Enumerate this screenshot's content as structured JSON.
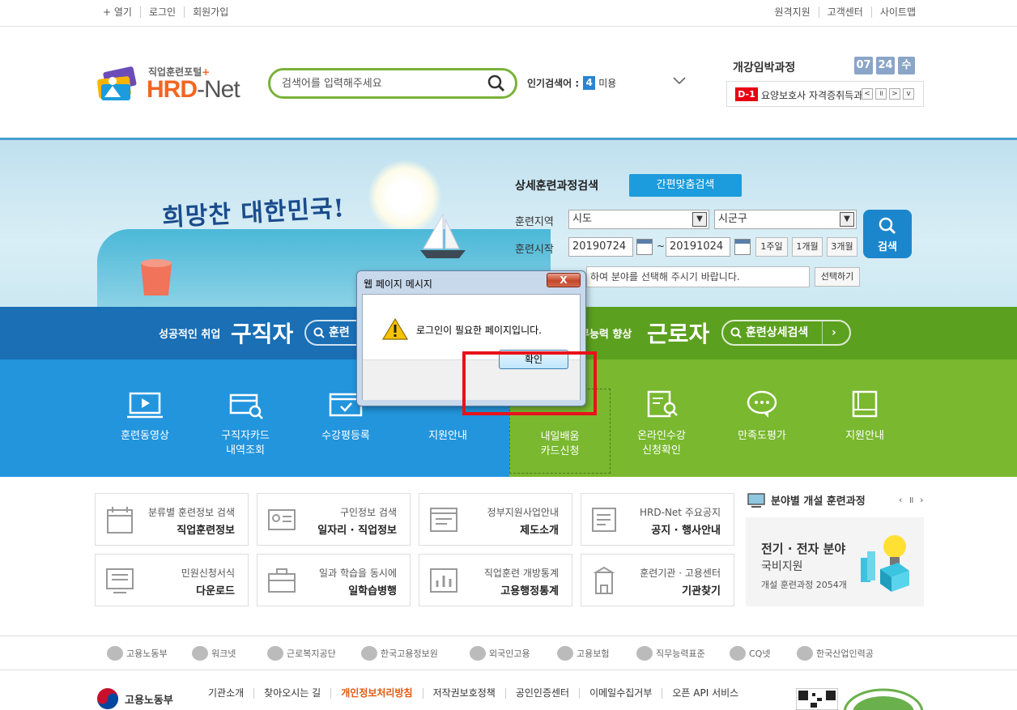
{
  "util": {
    "left": [
      "+ 열기",
      "로그인",
      "회원가입"
    ],
    "right": [
      "원격지원",
      "고객센터",
      "사이트맵"
    ]
  },
  "logo": {
    "pre": "직업훈련포털",
    "plus": "+",
    "hrd": "HRD",
    "net": "-Net"
  },
  "search": {
    "placeholder": "검색어를 입력해주세요"
  },
  "popular": {
    "label": "인기검색어 :",
    "rank": "4",
    "word": "미용"
  },
  "course": {
    "title": "개강임박과정",
    "month": "07",
    "day": "24",
    "weekday": "수",
    "dday": "D-1",
    "name": "요양보호사 자격증취득과정"
  },
  "hero": {
    "slogan": "희망찬 대한민국!",
    "form_title": "상세훈련과정검색",
    "quick_btn": "간편맞춤검색",
    "region_label": "훈련지역",
    "region_sido": "시도",
    "region_gugun": "시군구",
    "start_label": "훈련시작",
    "date_from": "20190724",
    "tilde": "~",
    "date_to": "20191024",
    "p1": "1주일",
    "p2": "1개월",
    "p3": "3개월",
    "field_text": "하여 분야를 선택해 주시기 바랍니다.",
    "select_btn": "선택하기",
    "search_btn": "검색"
  },
  "band": {
    "left_small": "성공적인 취업",
    "left_big": "구직자",
    "left_pill": "훈련",
    "right_small": "무능력 향상",
    "right_big": "근로자",
    "right_pill": "훈련상세검색"
  },
  "menu_left": [
    "훈련동영상",
    "구직자카드\n내역조회",
    "수강평등록",
    "지원안내"
  ],
  "menu_right": [
    "내일배움\n카드신청",
    "온라인수강\n신청확인",
    "만족도평가",
    "지원안내"
  ],
  "quick": [
    {
      "s": "분류별 훈련정보 검색",
      "b": "직업훈련정보"
    },
    {
      "s": "구인정보 검색",
      "b": "일자리 · 직업정보"
    },
    {
      "s": "정부지원사업안내",
      "b": "제도소개"
    },
    {
      "s": "HRD-Net 주요공지",
      "b": "공지 · 행사안내"
    },
    {
      "s": "민원신청서식",
      "b": "다운로드"
    },
    {
      "s": "일과 학습을 동시에",
      "b": "일학습병행"
    },
    {
      "s": "직업훈련 개방통계",
      "b": "고용행정통계"
    },
    {
      "s": "훈련기관 · 고용센터",
      "b": "기관찾기"
    }
  ],
  "field": {
    "head": "분야별 개설 훈련과정",
    "ctrl": "‹ ॥ ›",
    "t1": "전기 · 전자 분야",
    "t2": "국비지원",
    "t3": "개설 훈련과정 2054개"
  },
  "partners": [
    "고용노동부",
    "워크넷",
    "근로복지공단",
    "한국고용정보원",
    "외국인고용",
    "고용보험",
    "직무능력표준",
    "CQ넷",
    "한국산업인력공"
  ],
  "footer": {
    "logo": "고용노동부",
    "links": [
      "기관소개",
      "찾아오시는 길",
      "개인정보처리방침",
      "저작권보호정책",
      "공인인증센터",
      "이메일수집거부",
      "오픈 API 서비스"
    ]
  },
  "dialog": {
    "title": "웹 페이지 메시지",
    "message": "로그인이 필요한 페이지입니다.",
    "ok": "확인",
    "close": "X"
  },
  "colors": {
    "brand": "#f26522",
    "blue": "#2295dd",
    "green": "#79b82f",
    "highlight": "#e8121b"
  }
}
